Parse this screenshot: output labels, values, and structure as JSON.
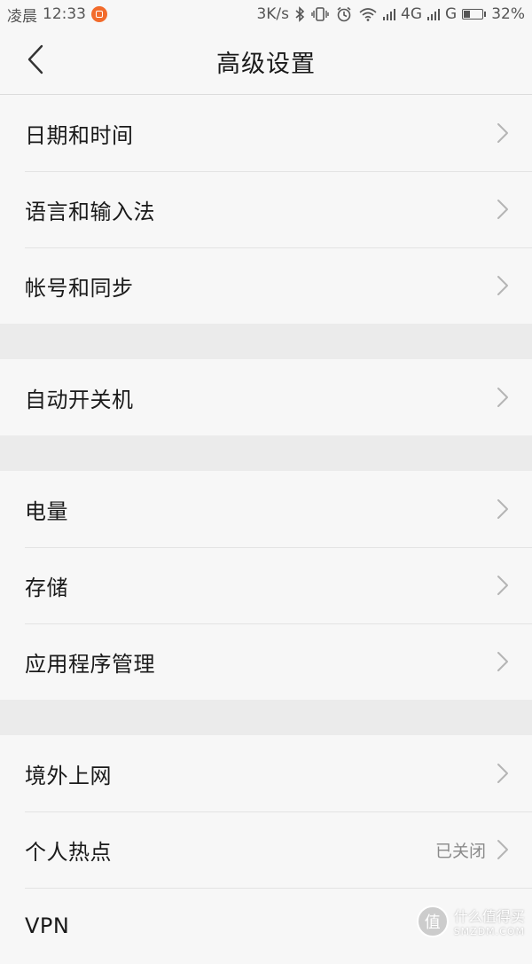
{
  "status_bar": {
    "carrier_text": "凌晨",
    "time": "12:33",
    "net_speed": "3K/s",
    "network_4g": "4G",
    "network_g": "G",
    "battery": "32%",
    "battery_level": 0.32,
    "icons": [
      "notification-icon",
      "bluetooth-icon",
      "vibrate-icon",
      "alarm-icon",
      "wifi-icon",
      "signal-icon",
      "signal-icon",
      "battery-icon"
    ]
  },
  "header": {
    "title": "高级设置",
    "back_icon": "back-icon"
  },
  "groups": [
    {
      "items": [
        {
          "label": "日期和时间"
        },
        {
          "label": "语言和输入法"
        },
        {
          "label": "帐号和同步"
        }
      ]
    },
    {
      "items": [
        {
          "label": "自动开关机"
        }
      ]
    },
    {
      "items": [
        {
          "label": "电量"
        },
        {
          "label": "存储"
        },
        {
          "label": "应用程序管理"
        }
      ]
    },
    {
      "items": [
        {
          "label": "境外上网"
        },
        {
          "label": "个人热点",
          "value": "已关闭"
        },
        {
          "label": "VPN"
        }
      ]
    }
  ],
  "watermark": {
    "logo_char": "值",
    "name": "什么值得买",
    "domain": "SMZDM.COM"
  },
  "colors": {
    "background": "#f7f7f7",
    "separator": "#ebebeb",
    "notification_accent": "#f26b2b",
    "text_primary": "#1a1a1a",
    "text_secondary": "#8a8a8a"
  }
}
